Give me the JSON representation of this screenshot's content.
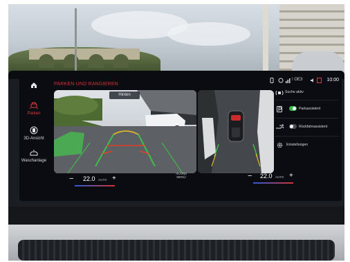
{
  "screen": {
    "title": "PARKEN UND RANGIEREN",
    "view_label": "Hinten",
    "colors": {
      "accent": "#d23434",
      "toggle_on": "#3cb54a",
      "background": "#0a0c12"
    }
  },
  "sidebar": {
    "items": [
      {
        "label": "",
        "icon": "home-icon",
        "active": false
      },
      {
        "label": "Parken",
        "icon": "parking-car-icon",
        "active": true
      },
      {
        "label": "3D-Ansicht",
        "icon": "3d-view-icon",
        "active": false
      },
      {
        "label": "Waschanlage",
        "icon": "car-wash-icon",
        "active": false
      }
    ]
  },
  "status": {
    "oe3": "! OE3",
    "time": "10:00"
  },
  "right_panel": {
    "search": "Suche aktiv",
    "park_assist": {
      "label": "Parkassistent",
      "enabled": true
    },
    "reverse_assist": {
      "label": "Rückfahrassistent",
      "enabled": false
    },
    "settings": "Einstellungen"
  },
  "climate": {
    "left": {
      "minus": "−",
      "temp": "22.0",
      "unit": "AUTO",
      "plus": "+"
    },
    "right": {
      "minus": "−",
      "temp": "22.0",
      "unit": "AUTO",
      "plus": "+"
    },
    "alarm_line1": "ALARM",
    "alarm_line2": "MENÜ"
  }
}
